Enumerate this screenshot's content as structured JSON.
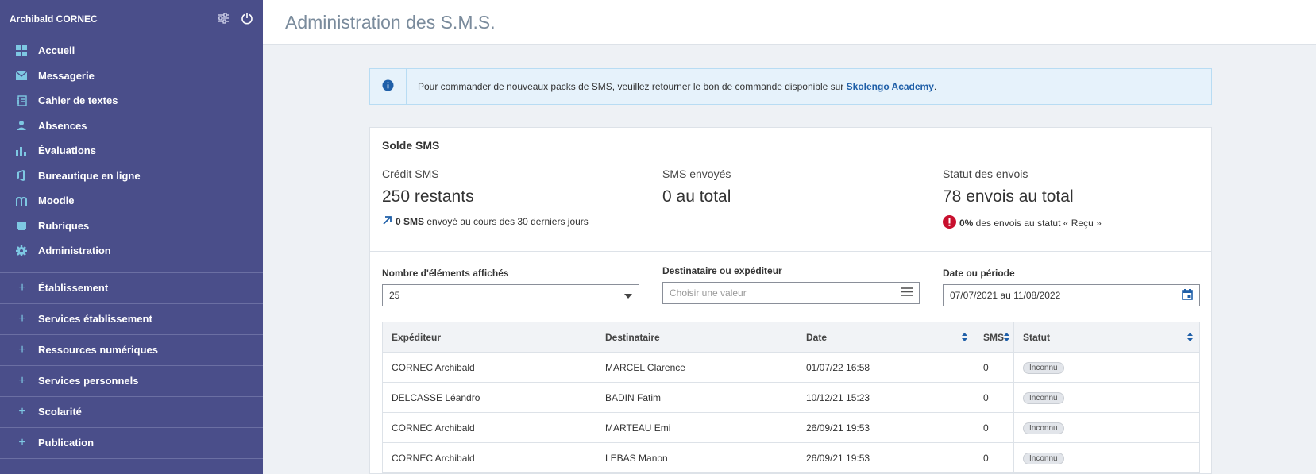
{
  "sidebar": {
    "user_name": "Archibald CORNEC",
    "nav": [
      {
        "label": "Accueil",
        "icon": "dashboard-icon"
      },
      {
        "label": "Messagerie",
        "icon": "mail-icon"
      },
      {
        "label": "Cahier de textes",
        "icon": "notebook-icon"
      },
      {
        "label": "Absences",
        "icon": "person-icon"
      },
      {
        "label": "Évaluations",
        "icon": "bar-chart-icon"
      },
      {
        "label": "Bureautique en ligne",
        "icon": "office-icon"
      },
      {
        "label": "Moodle",
        "icon": "moodle-icon"
      },
      {
        "label": "Rubriques",
        "icon": "book-icon"
      },
      {
        "label": "Administration",
        "icon": "gear-icon"
      }
    ],
    "sections": [
      {
        "label": "Établissement"
      },
      {
        "label": "Services établissement"
      },
      {
        "label": "Ressources numériques"
      },
      {
        "label": "Services personnels"
      },
      {
        "label": "Scolarité"
      },
      {
        "label": "Publication"
      }
    ]
  },
  "header": {
    "title_prefix": "Administration des ",
    "title_abbr": "S.M.S."
  },
  "info": {
    "text": "Pour commander de nouveaux packs de SMS, veuillez retourner le bon de commande disponible sur ",
    "link": "Skolengo Academy",
    "suffix": "."
  },
  "solde": {
    "title": "Solde SMS",
    "credit_label": "Crédit SMS",
    "credit_value": "250 restants",
    "credit_note_bold": "0 SMS",
    "credit_note": " envoyé au cours des 30 derniers jours",
    "sent_label": "SMS envoyés",
    "sent_value": "0 au total",
    "status_label": "Statut des envois",
    "status_value": "78 envois au total",
    "status_note_bold": "0%",
    "status_note": " des envois au statut « Reçu »"
  },
  "filters": {
    "count_label": "Nombre d'éléments affichés",
    "count_value": "25",
    "recipient_label": "Destinataire ou expéditeur",
    "recipient_placeholder": "Choisir une valeur",
    "date_label": "Date ou période",
    "date_value": "07/07/2021 au 11/08/2022"
  },
  "table": {
    "headers": [
      "Expéditeur",
      "Destinataire",
      "Date",
      "SMS",
      "Statut"
    ],
    "rows": [
      {
        "sender": "CORNEC Archibald",
        "recipient": "MARCEL Clarence",
        "date": "01/07/22 16:58",
        "sms": "0",
        "status": "Inconnu"
      },
      {
        "sender": "DELCASSE Léandro",
        "recipient": "BADIN Fatim",
        "date": "10/12/21 15:23",
        "sms": "0",
        "status": "Inconnu"
      },
      {
        "sender": "CORNEC Archibald",
        "recipient": "MARTEAU Emi",
        "date": "26/09/21 19:53",
        "sms": "0",
        "status": "Inconnu"
      },
      {
        "sender": "CORNEC Archibald",
        "recipient": "LEBAS Manon",
        "date": "26/09/21 19:53",
        "sms": "0",
        "status": "Inconnu"
      }
    ]
  },
  "colors": {
    "sidebar_bg": "#4a4e8a",
    "icon_accent": "#7ec8e3",
    "link": "#1f5fa8",
    "danger": "#c8102e"
  }
}
